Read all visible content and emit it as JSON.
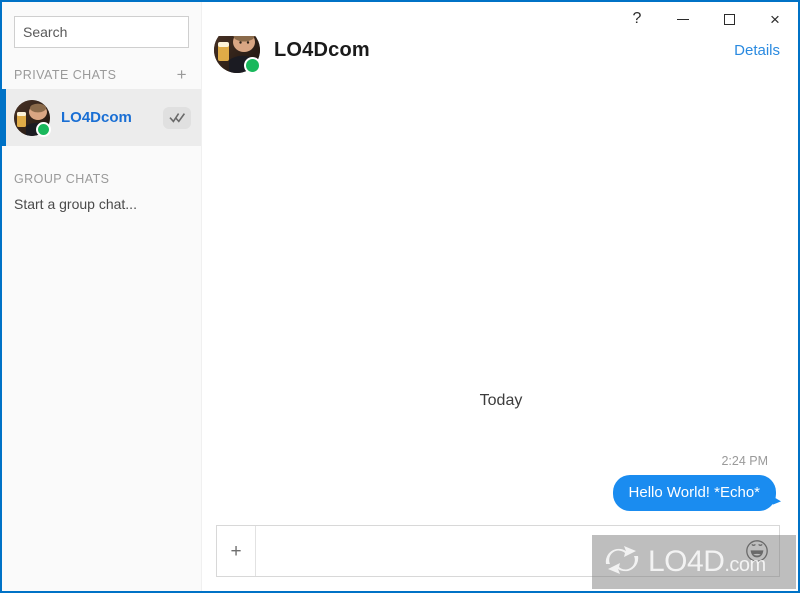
{
  "window": {
    "border_color": "#0072c6",
    "controls": [
      {
        "name": "help",
        "glyph": "?"
      },
      {
        "name": "minimize",
        "glyph": ""
      },
      {
        "name": "maximize",
        "glyph": ""
      },
      {
        "name": "close",
        "glyph": "×"
      }
    ]
  },
  "sidebar": {
    "search": {
      "placeholder": "Search",
      "value": ""
    },
    "private_chats": {
      "header": "PRIVATE CHATS",
      "add_label": "+",
      "items": [
        {
          "name": "LO4Dcom",
          "status": "online",
          "status_color": "#19b85c",
          "read_receipt_icon": "double-check-icon",
          "selected": true
        }
      ]
    },
    "group_chats": {
      "header": "GROUP CHATS",
      "empty_label": "Start a group chat..."
    }
  },
  "main": {
    "header": {
      "contact_name": "LO4Dcom",
      "status": "online",
      "details_label": "Details"
    },
    "conversation": {
      "day_divider": "Today",
      "messages": [
        {
          "time": "2:24 PM",
          "text": "Hello World! *Echo*",
          "direction": "outgoing",
          "bubble_color": "#1a8cf0"
        }
      ]
    },
    "composer": {
      "attach_label": "+",
      "input_value": "",
      "input_placeholder": "",
      "emoji_icon": "smiley-icon"
    }
  },
  "watermark": {
    "text": "LO4D",
    "suffix": ".com"
  }
}
